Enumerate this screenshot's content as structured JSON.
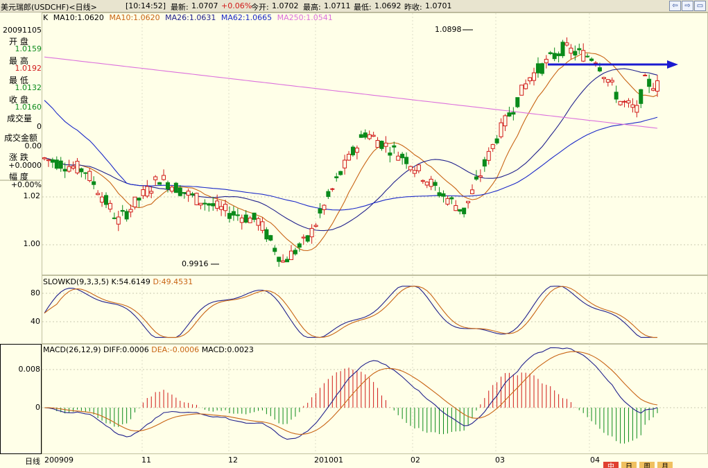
{
  "header": {
    "symbol_title": "美元瑞郎(USDCHF)<日线>",
    "time": "[10:14:52]",
    "latest_label": "最新:",
    "latest_value": "1.0707",
    "change": "+0.06%",
    "open_label": "今开:",
    "open_value": "1.0702",
    "high_label": "最高:",
    "high_value": "1.0711",
    "low_label": "最低:",
    "low_value": "1.0692",
    "prev_label": "昨收:",
    "prev_value": "1.0701",
    "nav_icons": [
      "arrow-left-icon",
      "arrow-right-icon",
      "window-icon"
    ]
  },
  "k_legend": {
    "k": "K",
    "ma10": "MA10:1.0620",
    "ma10b": "MA10:1.0620",
    "ma26": "MA26:1.0631",
    "ma62": "MA62:1.0665",
    "ma250": "MA250:1.0541"
  },
  "info_panel": {
    "date": "20091105",
    "open_label": "开  盘",
    "open_value": "1.0159",
    "high_label": "最  高",
    "high_value": "1.0192",
    "low_label": "最  低",
    "low_value": "1.0132",
    "close_label": "收  盘",
    "close_value": "1.0160",
    "volume_label": "成交量",
    "volume_value": "0",
    "amount_label": "成交金额",
    "amount_value": "0.00",
    "change_label": "涨  跌",
    "change_value": "+0.0000",
    "range_label": "幅  度",
    "range_value": "+0.00%"
  },
  "price_axis": {
    "t1": "1.02",
    "t2": "1.00"
  },
  "annotations": {
    "peak": "1.0898",
    "trough": "0.9916"
  },
  "kd_panel": {
    "title": "SLOWKD(9,3,3,5)",
    "k": "K:54.6149",
    "d": "D:49.4531",
    "t80": "80",
    "t40": "40"
  },
  "macd_panel": {
    "title": "MACD(26,12,9)",
    "diff": "DIFF:0.0006",
    "dea": "DEA:-0.0006",
    "macd": "MACD:0.0023",
    "t1": "0.008",
    "t0": "0"
  },
  "date_axis": {
    "period": "日线",
    "labels": [
      "200909",
      "11",
      "12",
      "201001",
      "02",
      "03",
      "04"
    ]
  },
  "bottom_buttons": [
    "中",
    "日",
    "周",
    "月"
  ],
  "colors": {
    "background": "#ffffe8",
    "up": "#d01818",
    "down": "#0a8a1a",
    "ma10": "#c86414",
    "ma26": "#20208c",
    "ma62": "#1a28c8",
    "ma250": "#dc70dc",
    "arrow": "#1a1ad0"
  },
  "chart_data": [
    {
      "type": "candlestick",
      "title": "美元瑞郎(USDCHF)<日线>",
      "x_range": [
        "2009-09",
        "2010-04"
      ],
      "ylim": [
        0.985,
        1.095
      ],
      "annotations": [
        {
          "label": "1.0898"
        },
        {
          "label": "0.9916"
        }
      ],
      "series": [
        {
          "name": "MA10",
          "last": 1.062
        },
        {
          "name": "MA26",
          "last": 1.0631
        },
        {
          "name": "MA62",
          "last": 1.0665
        },
        {
          "name": "MA250",
          "last": 1.0541
        }
      ]
    },
    {
      "type": "line",
      "title": "SLOWKD(9,3,3,5)",
      "ylim": [
        15,
        95
      ],
      "series": [
        {
          "name": "K",
          "last": 54.6149
        },
        {
          "name": "D",
          "last": 49.4531
        }
      ]
    },
    {
      "type": "bar",
      "title": "MACD(26,12,9)",
      "series": [
        {
          "name": "DIFF",
          "last": 0.0006
        },
        {
          "name": "DEA",
          "last": -0.0006
        },
        {
          "name": "MACD",
          "last": 0.0023
        }
      ]
    }
  ]
}
